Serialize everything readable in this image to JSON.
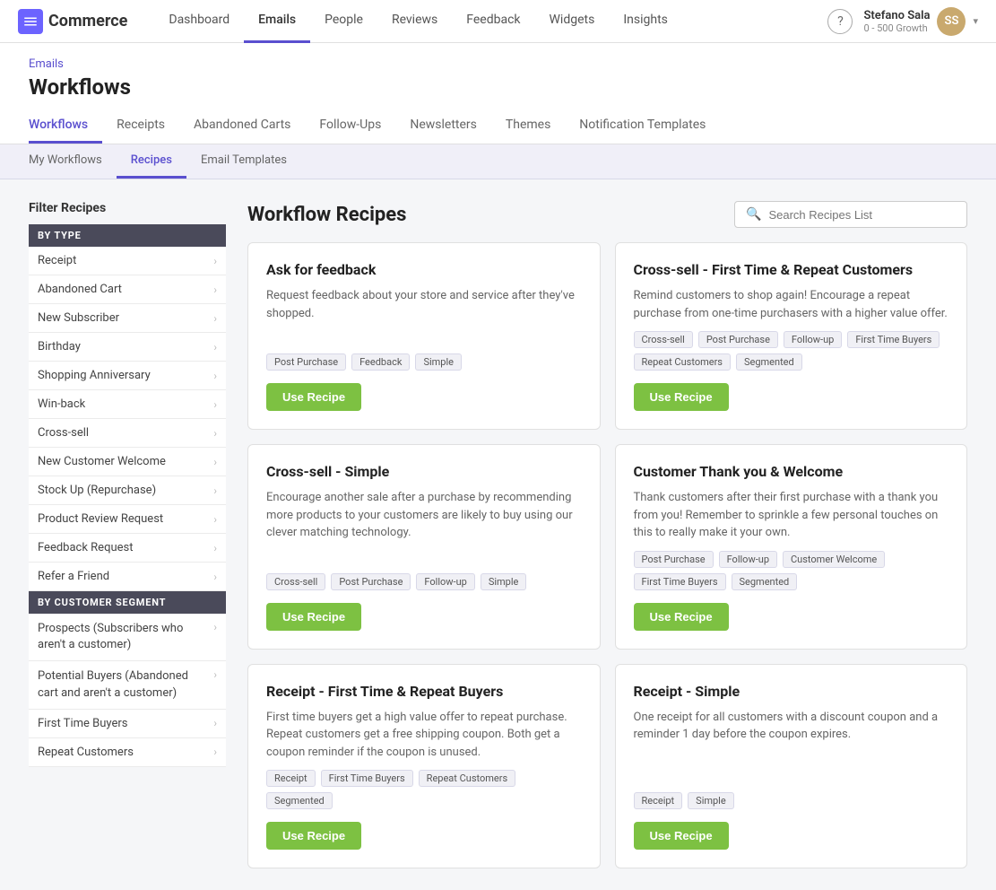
{
  "brand": {
    "name": "Commerce"
  },
  "nav": {
    "links": [
      {
        "label": "Dashboard",
        "active": false
      },
      {
        "label": "Emails",
        "active": true
      },
      {
        "label": "People",
        "active": false
      },
      {
        "label": "Reviews",
        "active": false
      },
      {
        "label": "Feedback",
        "active": false
      },
      {
        "label": "Widgets",
        "active": false
      },
      {
        "label": "Insights",
        "active": false
      }
    ]
  },
  "user": {
    "name": "Stefano Sala",
    "plan": "0 - 500 Growth",
    "initials": "SS"
  },
  "breadcrumb": "Emails",
  "pageTitle": "Workflows",
  "tabs": [
    {
      "label": "Workflows",
      "active": true
    },
    {
      "label": "Receipts",
      "active": false
    },
    {
      "label": "Abandoned Carts",
      "active": false
    },
    {
      "label": "Follow-Ups",
      "active": false
    },
    {
      "label": "Newsletters",
      "active": false
    },
    {
      "label": "Themes",
      "active": false
    },
    {
      "label": "Notification Templates",
      "active": false
    }
  ],
  "subTabs": [
    {
      "label": "My Workflows",
      "active": false
    },
    {
      "label": "Recipes",
      "active": true
    },
    {
      "label": "Email Templates",
      "active": false
    }
  ],
  "sidebar": {
    "filterTitle": "Filter Recipes",
    "byType": {
      "header": "BY TYPE",
      "items": [
        "Receipt",
        "Abandoned Cart",
        "New Subscriber",
        "Birthday",
        "Shopping Anniversary",
        "Win-back",
        "Cross-sell",
        "New Customer Welcome",
        "Stock Up (Repurchase)",
        "Product Review Request",
        "Feedback Request",
        "Refer a Friend"
      ]
    },
    "bySegment": {
      "header": "BY CUSTOMER SEGMENT",
      "items": [
        {
          "label": "Prospects (Subscribers who aren't a customer)",
          "long": true
        },
        {
          "label": "Potential Buyers (Abandoned cart and aren't a customer)",
          "long": true
        },
        {
          "label": "First Time Buyers",
          "long": false
        },
        {
          "label": "Repeat Customers",
          "long": false
        }
      ]
    }
  },
  "recipes": {
    "title": "Workflow Recipes",
    "search": {
      "placeholder": "Search Recipes List"
    },
    "cards": [
      {
        "title": "Ask for feedback",
        "desc": "Request feedback about your store and service after they've shopped.",
        "tags": [
          "Post Purchase",
          "Feedback",
          "Simple"
        ],
        "btnLabel": "Use Recipe"
      },
      {
        "title": "Cross-sell - First Time & Repeat Customers",
        "desc": "Remind customers to shop again! Encourage a repeat purchase from one-time purchasers with a higher value offer.",
        "tags": [
          "Cross-sell",
          "Post Purchase",
          "Follow-up",
          "First Time Buyers",
          "Repeat Customers",
          "Segmented"
        ],
        "btnLabel": "Use Recipe"
      },
      {
        "title": "Cross-sell - Simple",
        "desc": "Encourage another sale after a purchase by recommending more products to your customers are likely to buy using our clever matching technology.",
        "tags": [
          "Cross-sell",
          "Post Purchase",
          "Follow-up",
          "Simple"
        ],
        "btnLabel": "Use Recipe"
      },
      {
        "title": "Customer Thank you & Welcome",
        "desc": "Thank customers after their first purchase with a thank you from you! Remember to sprinkle a few personal touches on this to really make it your own.",
        "tags": [
          "Post Purchase",
          "Follow-up",
          "Customer Welcome",
          "First Time Buyers",
          "Segmented"
        ],
        "btnLabel": "Use Recipe"
      },
      {
        "title": "Receipt - First Time & Repeat Buyers",
        "desc": "First time buyers get a high value offer to repeat purchase. Repeat customers get a free shipping coupon. Both get a coupon reminder if the coupon is unused.",
        "tags": [
          "Receipt",
          "First Time Buyers",
          "Repeat Customers",
          "Segmented"
        ],
        "btnLabel": "Use Recipe"
      },
      {
        "title": "Receipt - Simple",
        "desc": "One receipt for all customers with a discount coupon and a reminder 1 day before the coupon expires.",
        "tags": [
          "Receipt",
          "Simple"
        ],
        "btnLabel": "Use Recipe"
      }
    ]
  }
}
